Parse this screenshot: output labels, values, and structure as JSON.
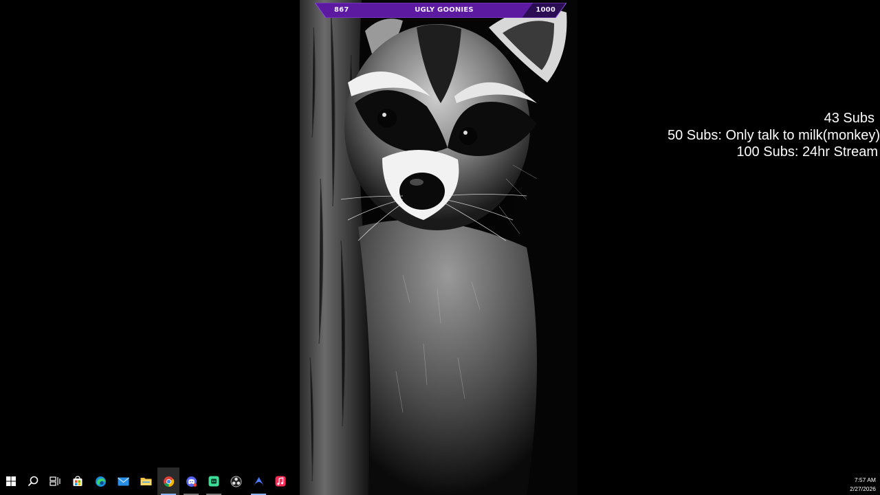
{
  "goal_bar": {
    "current": "867",
    "title": "UGLY GOONIES",
    "target": "1000",
    "bar_color": "#5b1aa0",
    "progress_fraction": 0.867
  },
  "sub_goals": {
    "line1": "43 Subs",
    "line2": "50 Subs: Only talk to milk(monkey)",
    "line3": "100 Subs: 24hr Stream"
  },
  "wallpaper": {
    "subject": "raccoon"
  },
  "taskbar": {
    "items": [
      {
        "name": "start-button",
        "icon": "windows-logo-icon"
      },
      {
        "name": "search-button",
        "icon": "search-icon"
      },
      {
        "name": "task-view-button",
        "icon": "task-view-icon"
      },
      {
        "name": "microsoft-store-button",
        "icon": "store-icon"
      },
      {
        "name": "edge-button",
        "icon": "edge-icon"
      },
      {
        "name": "mail-button",
        "icon": "mail-icon"
      },
      {
        "name": "file-explorer-button",
        "icon": "folder-icon"
      },
      {
        "name": "chrome-button",
        "icon": "chrome-icon",
        "active": true
      },
      {
        "name": "discord-button",
        "icon": "discord-icon"
      },
      {
        "name": "app-green-button",
        "icon": "green-app-icon"
      },
      {
        "name": "obs-button",
        "icon": "obs-icon"
      },
      {
        "name": "app-blue-button",
        "icon": "blue-app-icon"
      },
      {
        "name": "music-button",
        "icon": "music-icon"
      }
    ],
    "clock_time": "7:57 AM",
    "clock_date": "2/27/2026"
  }
}
